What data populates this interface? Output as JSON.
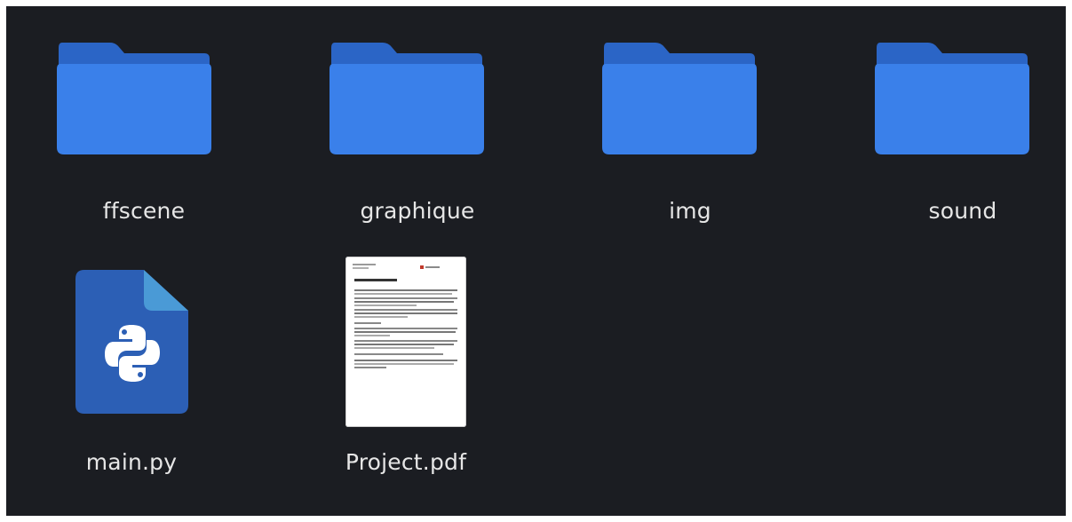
{
  "files": [
    {
      "name": "ffscene",
      "type": "folder",
      "icon": "folder-icon"
    },
    {
      "name": "graphique",
      "type": "folder",
      "icon": "folder-icon"
    },
    {
      "name": "img",
      "type": "folder",
      "icon": "folder-icon"
    },
    {
      "name": "sound",
      "type": "folder",
      "icon": "folder-icon"
    },
    {
      "name": "main.py",
      "type": "python",
      "icon": "python-file-icon"
    },
    {
      "name": "Project.pdf",
      "type": "pdf",
      "icon": "pdf-thumbnail-icon"
    }
  ],
  "colors": {
    "background": "#1b1d22",
    "folder_front": "#3a80ea",
    "folder_back": "#2b65c6",
    "python_file": "#2c5fb5",
    "python_fold": "#4a9ad6",
    "label": "#e6e6e6"
  }
}
